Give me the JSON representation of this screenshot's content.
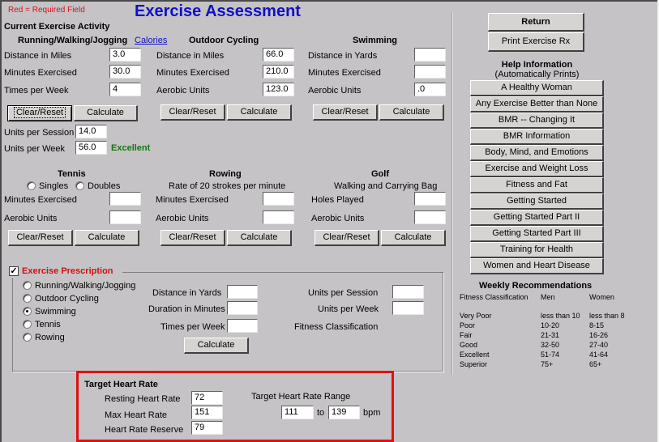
{
  "header": {
    "required_note": "Red = Required Field",
    "title": "Exercise Assessment"
  },
  "current_activity": {
    "heading": "Current Exercise Activity",
    "calories_link": "Calories",
    "running": {
      "heading": "Running/Walking/Jogging",
      "distance_label": "Distance in Miles",
      "distance_value": "3.0",
      "minutes_label": "Minutes Exercised",
      "minutes_value": "30.0",
      "times_label": "Times per Week",
      "times_value": "4"
    },
    "cycling": {
      "heading": "Outdoor Cycling",
      "distance_label": "Distance in Miles",
      "distance_value": "66.0",
      "minutes_label": "Minutes Exercised",
      "minutes_value": "210.0",
      "aerobic_label": "Aerobic Units",
      "aerobic_value": "123.0"
    },
    "swimming": {
      "heading": "Swimming",
      "distance_label": "Distance in Yards",
      "distance_value": "",
      "minutes_label": "Minutes Exercised",
      "minutes_value": "",
      "aerobic_label": "Aerobic Units",
      "aerobic_value": ".0"
    },
    "clear_label": "Clear/Reset",
    "calculate_label": "Calculate",
    "units_session_label": "Units per Session",
    "units_session_value": "14.0",
    "units_week_label": "Units per Week",
    "units_week_value": "56.0",
    "classification": "Excellent",
    "tennis": {
      "heading": "Tennis",
      "singles_label": "Singles",
      "doubles_label": "Doubles",
      "minutes_label": "Minutes Exercised",
      "minutes_value": "",
      "aerobic_label": "Aerobic Units",
      "aerobic_value": ""
    },
    "rowing": {
      "heading": "Rowing",
      "subheading": "Rate of 20 strokes per minute",
      "minutes_label": "Minutes Exercised",
      "minutes_value": "",
      "aerobic_label": "Aerobic Units",
      "aerobic_value": ""
    },
    "golf": {
      "heading": "Golf",
      "subheading": "Walking and Carrying Bag",
      "holes_label": "Holes Played",
      "holes_value": "",
      "aerobic_label": "Aerobic Units",
      "aerobic_value": ""
    }
  },
  "prescription": {
    "title": "Exercise Prescription",
    "checked": true,
    "options": [
      "Running/Walking/Jogging",
      "Outdoor Cycling",
      "Swimming",
      "Tennis",
      "Rowing"
    ],
    "selected": "Swimming",
    "distance_label": "Distance in Yards",
    "distance_value": "",
    "duration_label": "Duration in Minutes",
    "duration_value": "",
    "times_label": "Times per Week",
    "times_value": "",
    "units_session_label": "Units per Session",
    "units_session_value": "",
    "units_week_label": "Units per Week",
    "units_week_value": "",
    "fitness_label": "Fitness Classification",
    "calculate_label": "Calculate"
  },
  "heart_rate": {
    "title": "Target Heart Rate",
    "resting_label": "Resting Heart Rate",
    "resting_value": "72",
    "max_label": "Max Heart Rate",
    "max_value": "151",
    "reserve_label": "Heart Rate Reserve",
    "reserve_value": "79",
    "range_label": "Target Heart Rate Range",
    "range_low": "111",
    "to_label": "to",
    "range_high": "139",
    "unit": "bpm"
  },
  "sidebar": {
    "return_label": "Return",
    "print_label": "Print Exercise Rx",
    "help_heading": "Help Information",
    "help_subheading": "(Automatically Prints)",
    "help_items": [
      "A Healthy Woman",
      "Any Exercise Better than None",
      "BMR -- Changing It",
      "BMR Information",
      "Body, Mind, and Emotions",
      "Exercise and Weight Loss",
      "Fitness and Fat",
      "Getting Started",
      "Getting Started Part II",
      "Getting Started Part III",
      "Training for Health",
      "Women and Heart Disease"
    ],
    "recommendations": {
      "heading": "Weekly Recommendations",
      "columns": [
        "Fitness Classification",
        "Men",
        "Women"
      ],
      "rows": [
        [
          "Very Poor",
          "less than 10",
          "less than 8"
        ],
        [
          "Poor",
          "10-20",
          "8-15"
        ],
        [
          "Fair",
          "21-31",
          "16-26"
        ],
        [
          "Good",
          "32-50",
          "27-40"
        ],
        [
          "Excellent",
          "51-74",
          "41-64"
        ],
        [
          "Superior",
          "75+",
          "65+"
        ]
      ]
    }
  }
}
